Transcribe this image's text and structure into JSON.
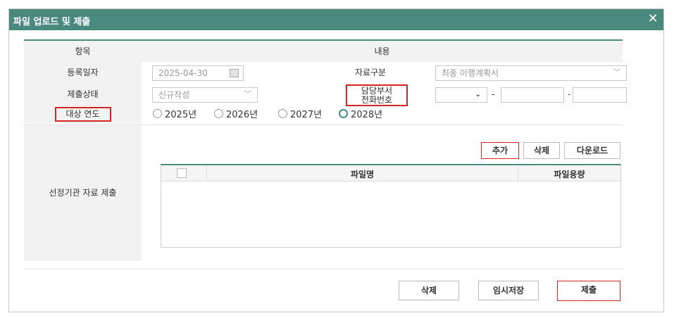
{
  "dialog": {
    "title": "파일 업로드 및 제출",
    "close_label": "✕"
  },
  "form": {
    "header": {
      "item": "항목",
      "content": "내용"
    },
    "reg_date": {
      "label": "등록일자",
      "value": "2025-04-30"
    },
    "data_type": {
      "label": "자료구분",
      "value": "최종 이행계획서"
    },
    "status": {
      "label": "제출상태",
      "value": "신규작성"
    },
    "dept_phone": {
      "label_line1": "담당부서",
      "label_line2": "전화번호",
      "dash1": "-",
      "dash2": "-"
    },
    "target_year": {
      "label": "대상 연도",
      "options": [
        "2025년",
        "2026년",
        "2027년",
        "2028년"
      ],
      "selected": "2028년"
    },
    "submission": {
      "label": "선정기관 자료 제출",
      "buttons": {
        "add": "추가",
        "delete": "삭제",
        "download": "다운로드"
      },
      "columns": {
        "filename": "파일명",
        "filesize": "파일용량"
      }
    }
  },
  "footer": {
    "delete": "삭제",
    "temp_save": "임시저장",
    "submit": "제출"
  },
  "colors": {
    "titlebar": "#4a8a7e",
    "highlight": "#d42424"
  }
}
